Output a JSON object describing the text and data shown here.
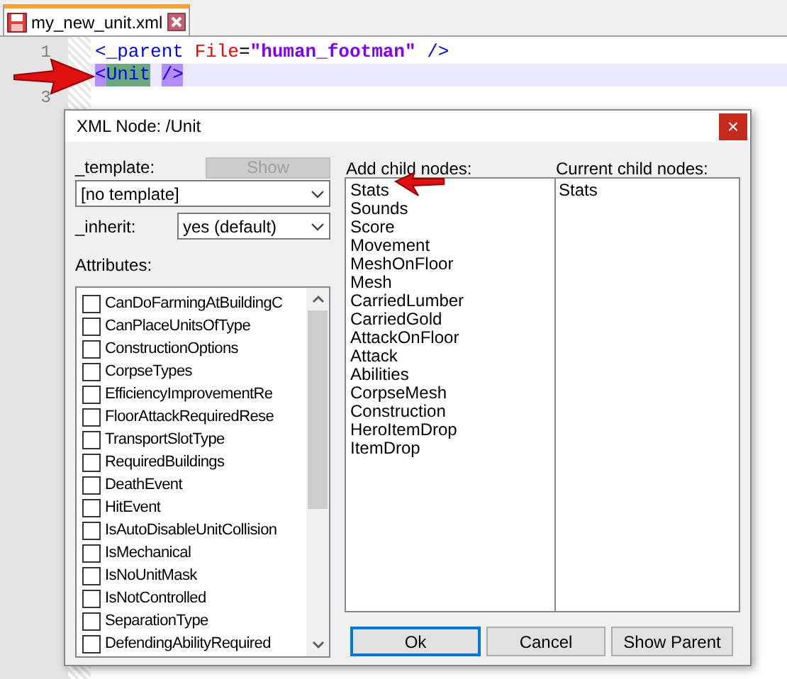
{
  "editor": {
    "tabs": [
      {
        "label": "my_new_unit.xml",
        "selected": true
      }
    ],
    "lines": [
      {
        "number": "1",
        "current": false,
        "tokens": [
          {
            "kind": "tag",
            "text": "<"
          },
          {
            "kind": "tag",
            "text": "_parent"
          },
          {
            "kind": "attr",
            "text": " File"
          },
          {
            "kind": "plain",
            "text": "="
          },
          {
            "kind": "string",
            "text": "\"human_footman\""
          },
          {
            "kind": "tag",
            "text": " />"
          }
        ]
      },
      {
        "current": true,
        "tokens": [
          {
            "kind": "match",
            "text": "<"
          },
          {
            "kind": "matchname",
            "text": "Unit"
          },
          {
            "kind": "match",
            "text": " />"
          }
        ]
      },
      {
        "number": "3",
        "current": false
      }
    ]
  },
  "dialog": {
    "title": "XML Node: /Unit",
    "close": "×",
    "template": {
      "label": "_template:",
      "value": "[no template]",
      "show_button": {
        "label": "Show",
        "disabled": true
      }
    },
    "inherit": {
      "label": "_inherit:",
      "value": "yes (default)"
    },
    "attributes": {
      "label": "Attributes:",
      "items": [
        {
          "label": "CanDoFarmingAtBuildingC",
          "checked": false
        },
        {
          "label": "CanPlaceUnitsOfType",
          "checked": false
        },
        {
          "label": "ConstructionOptions",
          "checked": false
        },
        {
          "label": "CorpseTypes",
          "checked": false
        },
        {
          "label": "EfficiencyImprovementRe",
          "checked": false
        },
        {
          "label": "FloorAttackRequiredRese",
          "checked": false
        },
        {
          "label": "TransportSlotType",
          "checked": false
        },
        {
          "label": "RequiredBuildings",
          "checked": false
        },
        {
          "label": "DeathEvent",
          "checked": false
        },
        {
          "label": "HitEvent",
          "checked": false
        },
        {
          "label": "IsAutoDisableUnitCollision",
          "checked": false
        },
        {
          "label": "IsMechanical",
          "checked": false
        },
        {
          "label": "IsNoUnitMask",
          "checked": false
        },
        {
          "label": "IsNotControlled",
          "checked": false
        },
        {
          "label": "SeparationType",
          "checked": false
        },
        {
          "label": "DefendingAbilityRequired",
          "checked": false
        }
      ]
    },
    "add_child_nodes": {
      "label": "Add child nodes:",
      "items": [
        "Stats",
        "Sounds",
        "Score",
        "Movement",
        "MeshOnFloor",
        "Mesh",
        "CarriedLumber",
        "CarriedGold",
        "AttackOnFloor",
        "Attack",
        "Abilities",
        "CorpseMesh",
        "Construction",
        "HeroItemDrop",
        "ItemDrop"
      ]
    },
    "current_child_nodes": {
      "label": "Current child nodes:",
      "items": [
        "Stats"
      ]
    },
    "buttons": [
      {
        "label": "Ok",
        "focused": true
      },
      {
        "label": "Cancel",
        "focused": false
      },
      {
        "label": "Show Parent",
        "focused": false
      }
    ]
  }
}
